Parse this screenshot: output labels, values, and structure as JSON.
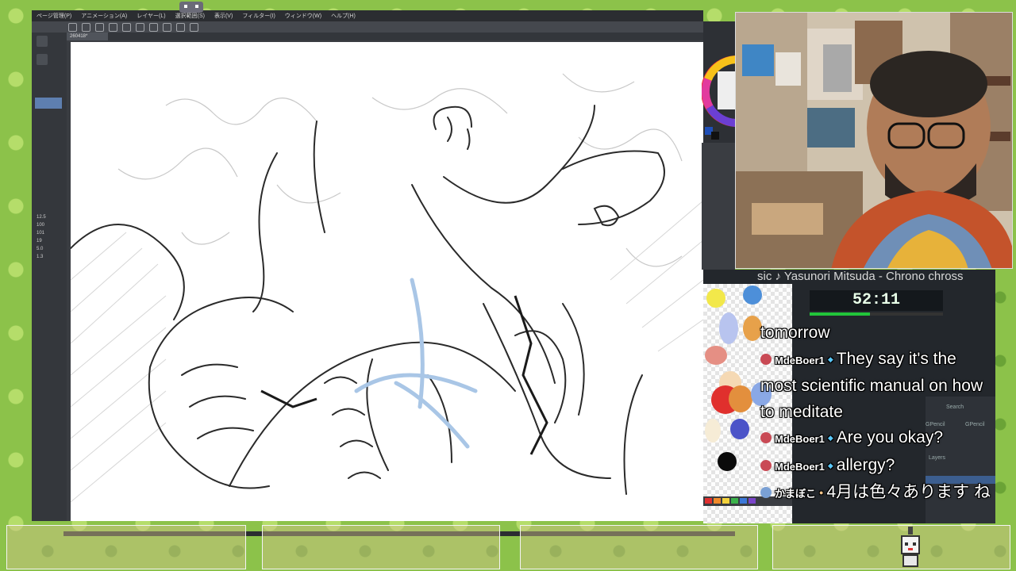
{
  "app": {
    "menu": [
      "ページ管理(P)",
      "アニメーション(A)",
      "レイヤー(L)",
      "選択範囲(S)",
      "表示(V)",
      "フィルター(I)",
      "ウィンドウ(W)",
      "ヘルプ(H)"
    ],
    "tab_label": "260418*",
    "tool_values": [
      "12.5",
      "100",
      "101",
      "19",
      "5.0",
      "1.3"
    ]
  },
  "overlay": {
    "now_playing": "sic ♪ Yasunori Mitsuda - Chrono chross",
    "timer": "52:11",
    "timer_progress": 0.45,
    "blender_labels": {
      "search": "Search",
      "gpencil_a": "GPencil",
      "gpencil_b": "GPencil",
      "layers": "Layers"
    },
    "chat": [
      {
        "user": "",
        "text": "tomorrow"
      },
      {
        "user": "MdeBoer1",
        "text": "They say it's the most scientific manual on how to meditate"
      },
      {
        "user": "MdeBoer1",
        "text": "Are you okay?"
      },
      {
        "user": "MdeBoer1",
        "text": "allergy?"
      },
      {
        "user": "かまぼこ",
        "text": "4月は色々あります ね"
      }
    ]
  },
  "colors": {
    "background": "#8cc24a",
    "timer_fill": "#22c53a",
    "badge": "#c94a55"
  }
}
